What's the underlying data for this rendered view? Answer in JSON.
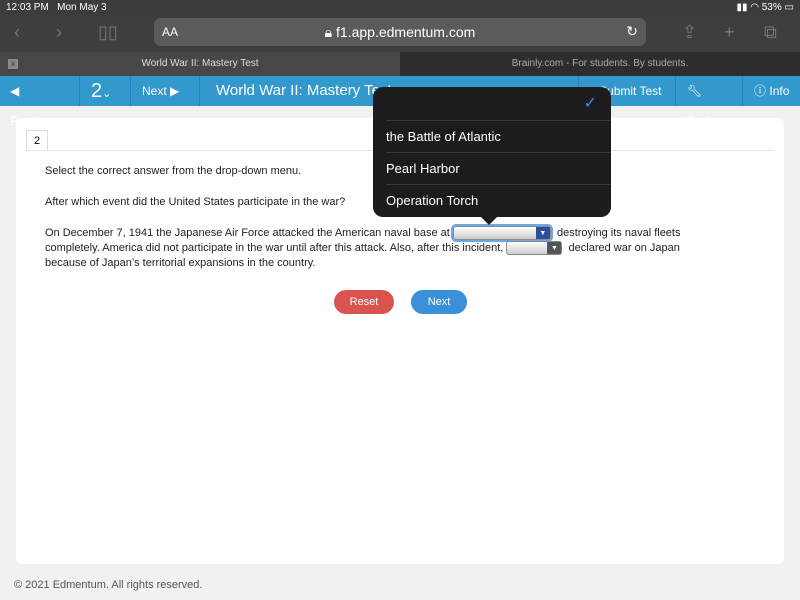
{
  "status": {
    "time": "12:03 PM",
    "date": "Mon May 3",
    "battery": "53%"
  },
  "browser": {
    "aa": "AA",
    "url": "f1.app.edmentum.com",
    "tabs": [
      {
        "label": "World War II: Mastery Test"
      },
      {
        "label": "Brainly.com - For students. By students."
      }
    ]
  },
  "nav": {
    "previous": "Previous",
    "question": "2",
    "next": "Next",
    "title": "World War II: Mastery Test",
    "submit": "Submit Test",
    "tools": "Tools",
    "info": "Info"
  },
  "question": {
    "number": "2",
    "instruction": "Select the correct answer from the drop-down menu.",
    "prompt": "After which event did the United States participate in the war?",
    "text1": "On December 7, 1941 the Japanese Air Force attacked the American naval base at",
    "text2": ", destroying its naval fleets",
    "text3": "completely. America did not participate in the war until after this attack. Also, after this incident,",
    "text4": "declared war on Japan",
    "text5": "because of Japan’s territorial expansions in the country."
  },
  "buttons": {
    "reset": "Reset",
    "next": "Next"
  },
  "dropdown": {
    "options": [
      "the Battle of Atlantic",
      "Pearl Harbor",
      "Operation Torch"
    ]
  },
  "footer": "© 2021 Edmentum. All rights reserved.",
  "colors": {
    "nav": "#3399cc",
    "reset": "#d9534f",
    "next": "#3a8fd9"
  }
}
